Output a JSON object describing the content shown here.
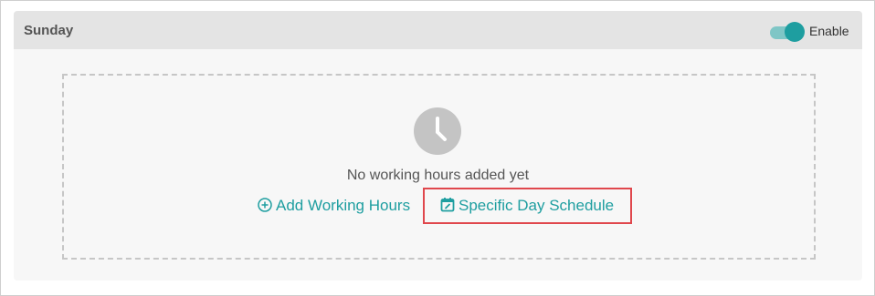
{
  "day": {
    "title": "Sunday",
    "enabled": true,
    "toggle_label": "Enable"
  },
  "empty_state": {
    "icon": "clock-icon",
    "message": "No working hours added yet"
  },
  "actions": {
    "add_working_hours": {
      "label": "Add Working Hours",
      "icon": "plus-circle-icon"
    },
    "specific_day_schedule": {
      "label": "Specific Day Schedule",
      "icon": "calendar-edit-icon"
    }
  },
  "colors": {
    "accent": "#1e9ea0",
    "highlight": "#e0474c",
    "header_bg": "#e4e4e4",
    "panel_bg": "#f7f7f7"
  }
}
